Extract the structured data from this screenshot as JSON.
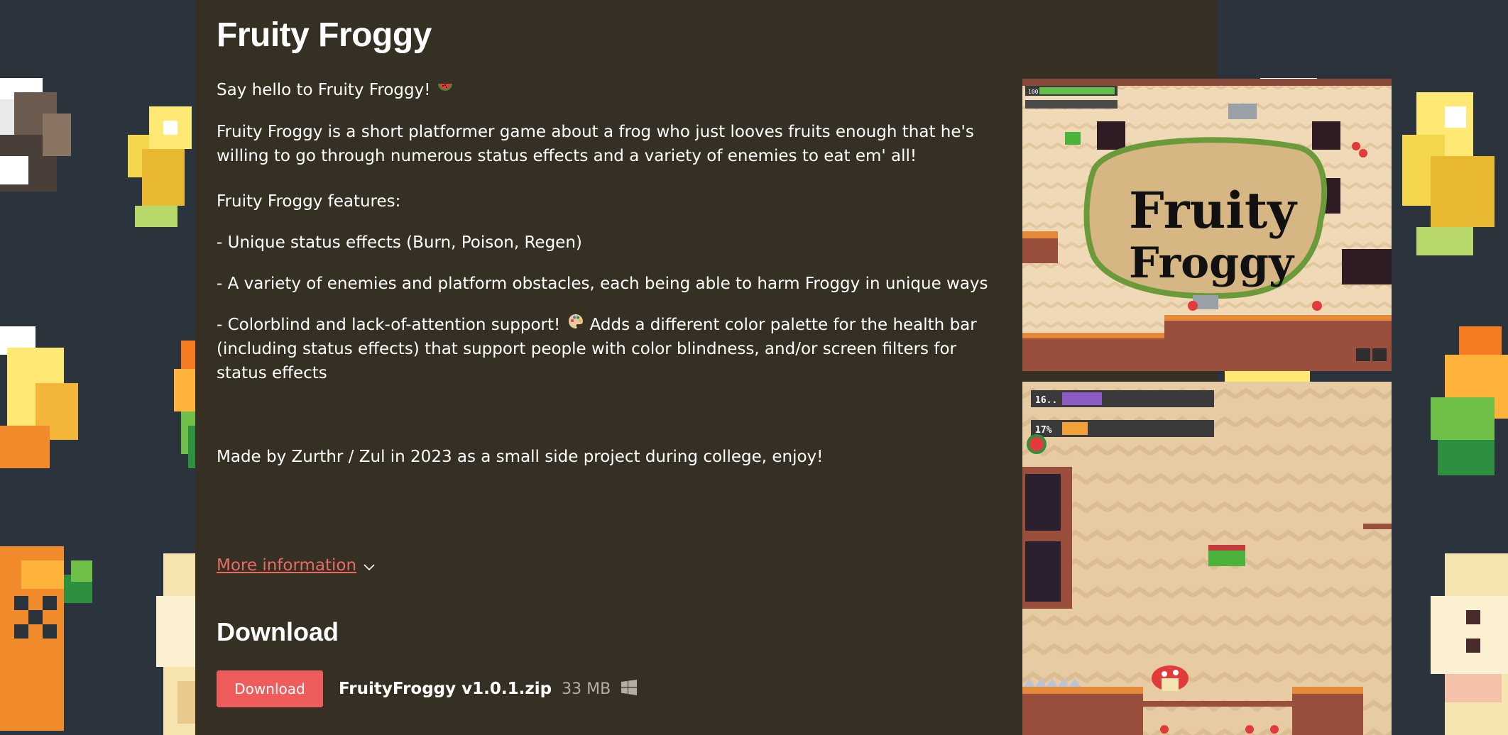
{
  "game": {
    "title": "Fruity Froggy",
    "description": [
      "Say hello to Fruity Froggy!",
      "Fruity Froggy is a short platformer game about a frog who just looves fruits enough that he's willing to go through numerous status effects and a variety of enemies to eat em' all!",
      "Fruity Froggy features:",
      "- Unique status effects (Burn, Poison, Regen)",
      "- A variety of enemies and platform obstacles, each being able to harm Froggy in unique ways",
      "- Colorblind and lack-of-attention support!",
      "Adds a different color palette for the health bar (including status effects) that support people with color blindness, and/or screen filters for status effects",
      "Made by Zurthr / Zul in 2023 as a small side project during college, enjoy!"
    ],
    "more_info": "More information"
  },
  "download": {
    "heading": "Download",
    "button_label": "Download",
    "file_name": "FruityFroggy v1.0.1.zip",
    "file_size": "33 MB",
    "platform_icon": "windows-icon"
  },
  "screenshots": {
    "shot1": {
      "hud_values": [
        "100"
      ],
      "logo_text": "Fruity Froggy"
    },
    "shot2": {
      "hud_values": [
        "16..",
        "17%"
      ]
    }
  },
  "colors": {
    "page_bg": "#2b333d",
    "column_bg": "#363024",
    "link": "#e96a63",
    "button": "#ef5c5c"
  }
}
